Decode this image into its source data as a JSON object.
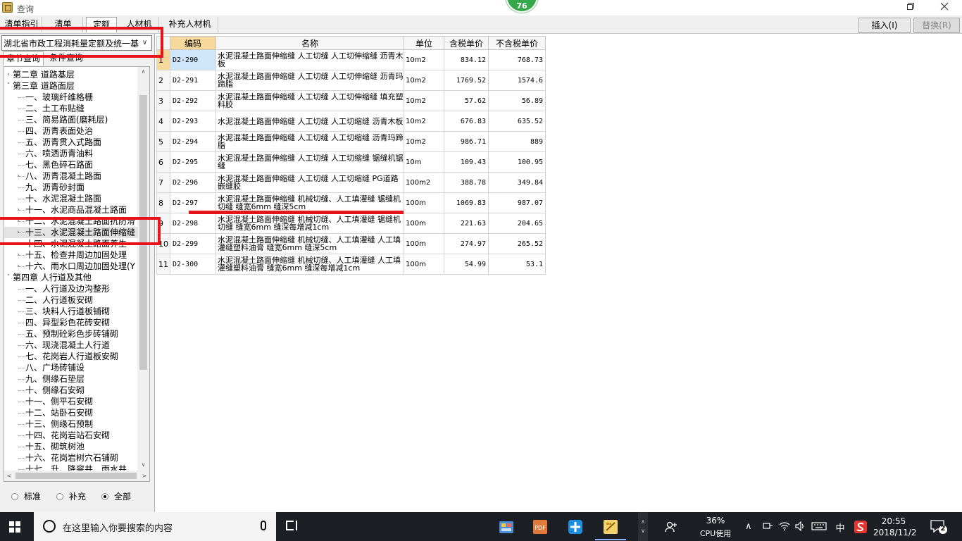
{
  "window": {
    "title": "查询",
    "badge": "76"
  },
  "tabs": [
    {
      "label": "清单指引"
    },
    {
      "label": "清单"
    },
    {
      "label": "定额"
    },
    {
      "label": "人材机"
    },
    {
      "label": "补充人材机"
    }
  ],
  "actions": {
    "insert_label": "插入(I)",
    "replace_label": "替换(R)"
  },
  "left": {
    "library": "湖北省市政工程消耗量定额及统一基",
    "subtabs": [
      "章节查询",
      "条件查询"
    ],
    "tree": [
      {
        "label": "第二章  道路基层"
      },
      {
        "label": "第三章  道路面层"
      },
      {
        "label": "一、玻璃纤维格栅"
      },
      {
        "label": "二、土工布贴缝"
      },
      {
        "label": "三、简易路面(磨耗层)"
      },
      {
        "label": "四、沥青表面处治"
      },
      {
        "label": "五、沥青贯入式路面"
      },
      {
        "label": "六、喷洒沥青油料"
      },
      {
        "label": "七、黑色碎石路面"
      },
      {
        "label": "八、沥青混凝土路面"
      },
      {
        "label": "九、沥青砂封面"
      },
      {
        "label": "十、水泥混凝土路面"
      },
      {
        "label": "十一、水泥商品混凝土路面"
      },
      {
        "label": "十二、水泥混凝土路面抗防滑"
      },
      {
        "label": "十三、水泥混凝土路面伸缩缝"
      },
      {
        "label": "十四、水泥混凝土路面养生"
      },
      {
        "label": "十五、检查井周边加固处理"
      },
      {
        "label": "十六、雨水口周边加固处理(Y"
      },
      {
        "label": "第四章  人行道及其他"
      },
      {
        "label": "一、人行道及边沟整形"
      },
      {
        "label": "二、人行道板安砌"
      },
      {
        "label": "三、块料人行道板铺砌"
      },
      {
        "label": "四、异型彩色花砖安砌"
      },
      {
        "label": "五、预制砼彩色步砖铺砌"
      },
      {
        "label": "六、现浇混凝土人行道"
      },
      {
        "label": "七、花岗岩人行道板安砌"
      },
      {
        "label": "八、广场砖铺设"
      },
      {
        "label": "九、侧缘石垫层"
      },
      {
        "label": "十、侧缘石安砌"
      },
      {
        "label": "十一、侧平石安砌"
      },
      {
        "label": "十二、站卧石安砌"
      },
      {
        "label": "十三、侧缘石预制"
      },
      {
        "label": "十四、花岗岩站石安砌"
      },
      {
        "label": "十五、砌筑树池"
      },
      {
        "label": "十六、花岗岩树穴石铺砌"
      },
      {
        "label": "十七、升、降窨井、雨水井"
      }
    ],
    "radios": [
      "标准",
      "补充",
      "全部"
    ]
  },
  "grid": {
    "headers": [
      "编码",
      "名称",
      "单位",
      "含税单价",
      "不含税单价"
    ],
    "rows": [
      {
        "n": "1",
        "code": "D2-290",
        "name": "水泥混凝土路面伸缩缝 人工切缝 人工切伸缩缝 沥青木板",
        "unit": "10m2",
        "p1": "834.12",
        "p2": "768.73"
      },
      {
        "n": "2",
        "code": "D2-291",
        "name": "水泥混凝土路面伸缩缝 人工切缝 人工切伸缩缝 沥青玛蹄脂",
        "unit": "10m2",
        "p1": "1769.52",
        "p2": "1574.6"
      },
      {
        "n": "3",
        "code": "D2-292",
        "name": "水泥混凝土路面伸缩缝 人工切缝 人工切伸缩缝 填充塑料胶",
        "unit": "10m2",
        "p1": "57.62",
        "p2": "56.89"
      },
      {
        "n": "4",
        "code": "D2-293",
        "name": "水泥混凝土路面伸缩缝 人工切缝 人工切缩缝 沥青木板",
        "unit": "10m2",
        "p1": "676.83",
        "p2": "635.52"
      },
      {
        "n": "5",
        "code": "D2-294",
        "name": "水泥混凝土路面伸缩缝 人工切缝 人工切缩缝 沥青玛蹄脂",
        "unit": "10m2",
        "p1": "986.71",
        "p2": "889"
      },
      {
        "n": "6",
        "code": "D2-295",
        "name": "水泥混凝土路面伸缩缝 人工切缝 人工切缩缝 锯缝机锯缝",
        "unit": "10m",
        "p1": "109.43",
        "p2": "100.95"
      },
      {
        "n": "7",
        "code": "D2-296",
        "name": "水泥混凝土路面伸缩缝 人工切缝 人工切缩缝 PG道路嵌缝胶",
        "unit": "100m2",
        "p1": "388.78",
        "p2": "349.84"
      },
      {
        "n": "8",
        "code": "D2-297",
        "name": "水泥混凝土路面伸缩缝 机械切缝、人工填灌缝 锯缝机切缝 缝宽6mm 缝深5cm",
        "unit": "100m",
        "p1": "1069.83",
        "p2": "987.07"
      },
      {
        "n": "9",
        "code": "D2-298",
        "name": "水泥混凝土路面伸缩缝 机械切缝、人工填灌缝 锯缝机切缝 缝宽6mm 缝深每增减1cm",
        "unit": "100m",
        "p1": "221.63",
        "p2": "204.65"
      },
      {
        "n": "10",
        "code": "D2-299",
        "name": "水泥混凝土路面伸缩缝 机械切缝、人工填灌缝 人工填灌缝塑料油膏 缝宽6mm 缝深5cm",
        "unit": "100m",
        "p1": "274.97",
        "p2": "265.52"
      },
      {
        "n": "11",
        "code": "D2-300",
        "name": "水泥混凝土路面伸缩缝 机械切缝、人工填灌缝 人工填灌缝塑料油膏 缝宽6mm 缝深每增减1cm",
        "unit": "100m",
        "p1": "54.99",
        "p2": "53.1"
      }
    ]
  },
  "taskbar": {
    "search_placeholder": "在这里输入你要搜索的内容",
    "cpu_percent": "36%",
    "cpu_label": "CPU使用",
    "ime": "中",
    "time": "20:55",
    "date": "2018/11/2",
    "notifications": "2"
  },
  "annotation_color": "#e8141b"
}
